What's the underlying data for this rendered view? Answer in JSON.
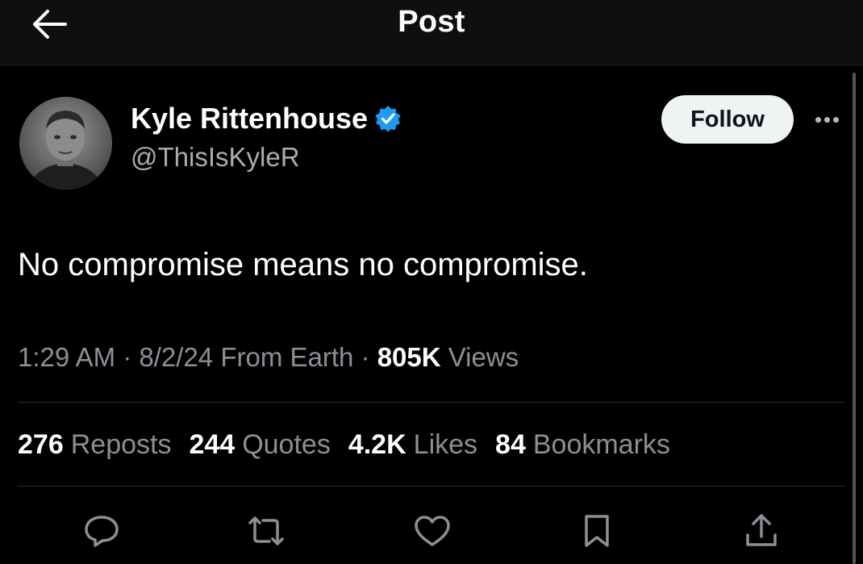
{
  "header": {
    "title": "Post",
    "back_icon": "arrow-left-icon"
  },
  "author": {
    "name": "Kyle Rittenhouse",
    "handle": "@ThisIsKyleR",
    "verified_icon": "verified-badge-icon",
    "verified_color": "#1d9bf0"
  },
  "follow_label": "Follow",
  "more_icon": "more-dots-icon",
  "post": {
    "text": "No compromise means no compromise."
  },
  "meta": {
    "time": "1:29 AM",
    "sep1": " · ",
    "date": "8/2/24",
    "source": " From Earth",
    "sep2": " · ",
    "views_count": "805K",
    "views_label": " Views"
  },
  "stats": [
    {
      "count": "276",
      "label": "Reposts"
    },
    {
      "count": "244",
      "label": "Quotes"
    },
    {
      "count": "4.2K",
      "label": "Likes"
    },
    {
      "count": "84",
      "label": "Bookmarks"
    }
  ],
  "action_icons": [
    "reply-icon",
    "repost-icon",
    "like-icon",
    "bookmark-icon",
    "share-icon"
  ],
  "colors": {
    "background": "#000000",
    "header": "#0f0f0f",
    "text": "#e7e9ea",
    "secondary": "#8b9096"
  }
}
